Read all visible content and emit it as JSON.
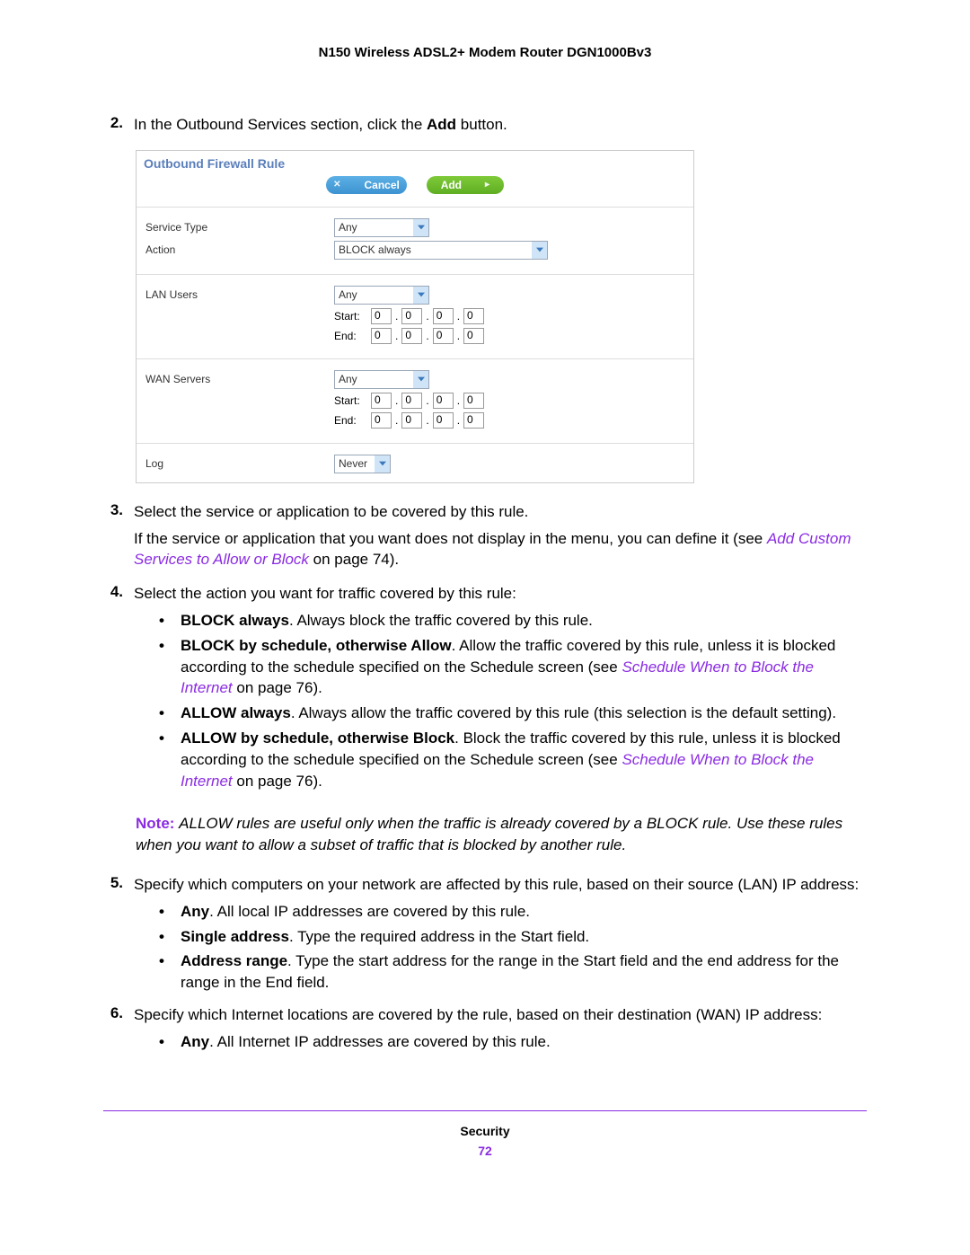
{
  "header": {
    "title": "N150 Wireless ADSL2+ Modem Router DGN1000Bv3"
  },
  "footer": {
    "section": "Security",
    "page": "72"
  },
  "screenshot": {
    "title": "Outbound Firewall Rule",
    "buttons": {
      "cancel": "Cancel",
      "add": "Add"
    },
    "labels": {
      "service_type": "Service Type",
      "action": "Action",
      "lan_users": "LAN Users",
      "wan_servers": "WAN Servers",
      "log": "Log",
      "start": "Start:",
      "end": "End:"
    },
    "values": {
      "service_type": "Any",
      "action": "BLOCK always",
      "lan_users": "Any",
      "wan_servers": "Any",
      "log": "Never",
      "lan_start": [
        "0",
        "0",
        "0",
        "0"
      ],
      "lan_end": [
        "0",
        "0",
        "0",
        "0"
      ],
      "wan_start": [
        "0",
        "0",
        "0",
        "0"
      ],
      "wan_end": [
        "0",
        "0",
        "0",
        "0"
      ]
    }
  },
  "steps": {
    "s2": {
      "num": "2.",
      "text_a": "In the Outbound Services section, click the ",
      "bold": "Add",
      "text_b": " button."
    },
    "s3": {
      "num": "3.",
      "line1": "Select the service or application to be covered by this rule.",
      "line2a": "If the service or application that you want does not display in the menu, you can define it (see ",
      "link": "Add Custom Services to Allow or Block",
      "line2b": " on page 74)."
    },
    "s4": {
      "num": "4.",
      "intro": "Select the action you want for traffic covered by this rule:",
      "b1": {
        "bold": "BLOCK always",
        "rest": ". Always block the traffic covered by this rule."
      },
      "b2": {
        "bold": "BLOCK by schedule, otherwise Allow",
        "rest_a": ". Allow the traffic covered by this rule, unless it is blocked according to the schedule specified on the Schedule screen (see ",
        "link": "Schedule When to Block the Internet",
        "rest_b": " on page 76)."
      },
      "b3": {
        "bold": "ALLOW always",
        "rest": ". Always allow the traffic covered by this rule (this selection is the default setting)."
      },
      "b4": {
        "bold": "ALLOW by schedule, otherwise Block",
        "rest_a": ". Block the traffic covered by this rule, unless it is blocked according to the schedule specified on the Schedule screen (see ",
        "link": "Schedule When to Block the Internet",
        "rest_b": " on page 76)."
      },
      "note": {
        "label": "Note:  ",
        "text": "ALLOW rules are useful only when the traffic is already covered by a BLOCK rule. Use these rules when you want to allow a subset of traffic that is blocked by another rule."
      }
    },
    "s5": {
      "num": "5.",
      "intro": "Specify which computers on your network are affected by this rule, based on their source (LAN) IP address:",
      "b1": {
        "bold": "Any",
        "rest": ". All local IP addresses are covered by this rule."
      },
      "b2": {
        "bold": "Single address",
        "rest": ". Type the required address in the Start field."
      },
      "b3": {
        "bold": "Address range",
        "rest": ". Type the start address for the range in the Start field and the end address for the range in the End field."
      }
    },
    "s6": {
      "num": "6.",
      "intro": "Specify which Internet locations are covered by the rule, based on their destination (WAN) IP address:",
      "b1": {
        "bold": "Any",
        "rest": ". All Internet IP addresses are covered by this rule."
      }
    }
  }
}
